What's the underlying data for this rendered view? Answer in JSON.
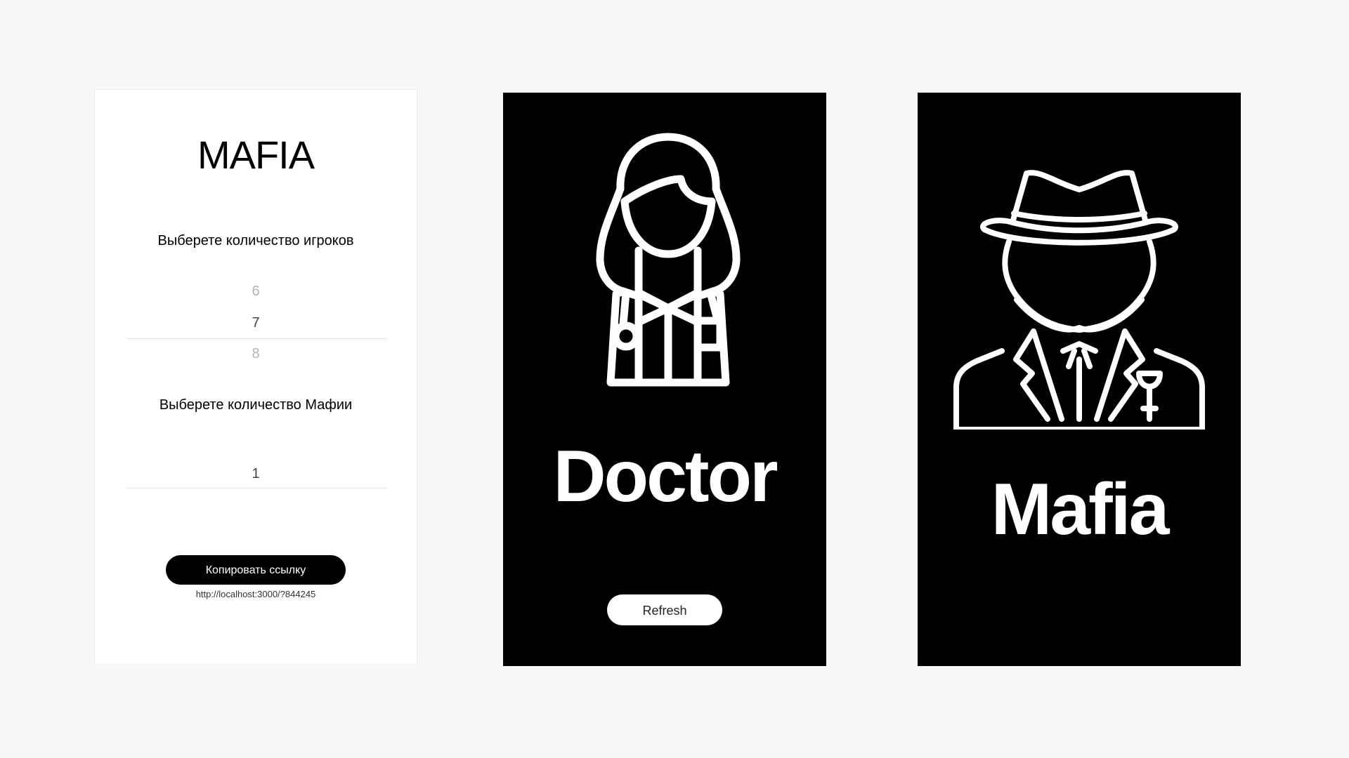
{
  "setup": {
    "title": "MAFIA",
    "players_label": "Выберете количество игроков",
    "players_options": [
      "6",
      "7",
      "8"
    ],
    "players_selected": "7",
    "mafia_label": "Выберете количество Мафии",
    "mafia_options": [
      "1"
    ],
    "mafia_selected": "1",
    "copy_button": "Копировать ссылку",
    "link_url": "http://localhost:3000/?844245"
  },
  "cards": [
    {
      "role": "Doctor",
      "icon": "doctor-icon",
      "refresh_button": "Refresh"
    },
    {
      "role": "Mafia",
      "icon": "mafia-icon"
    }
  ],
  "colors": {
    "background": "#f8f8f8",
    "card": "#000000",
    "accent": "#ffffff"
  }
}
